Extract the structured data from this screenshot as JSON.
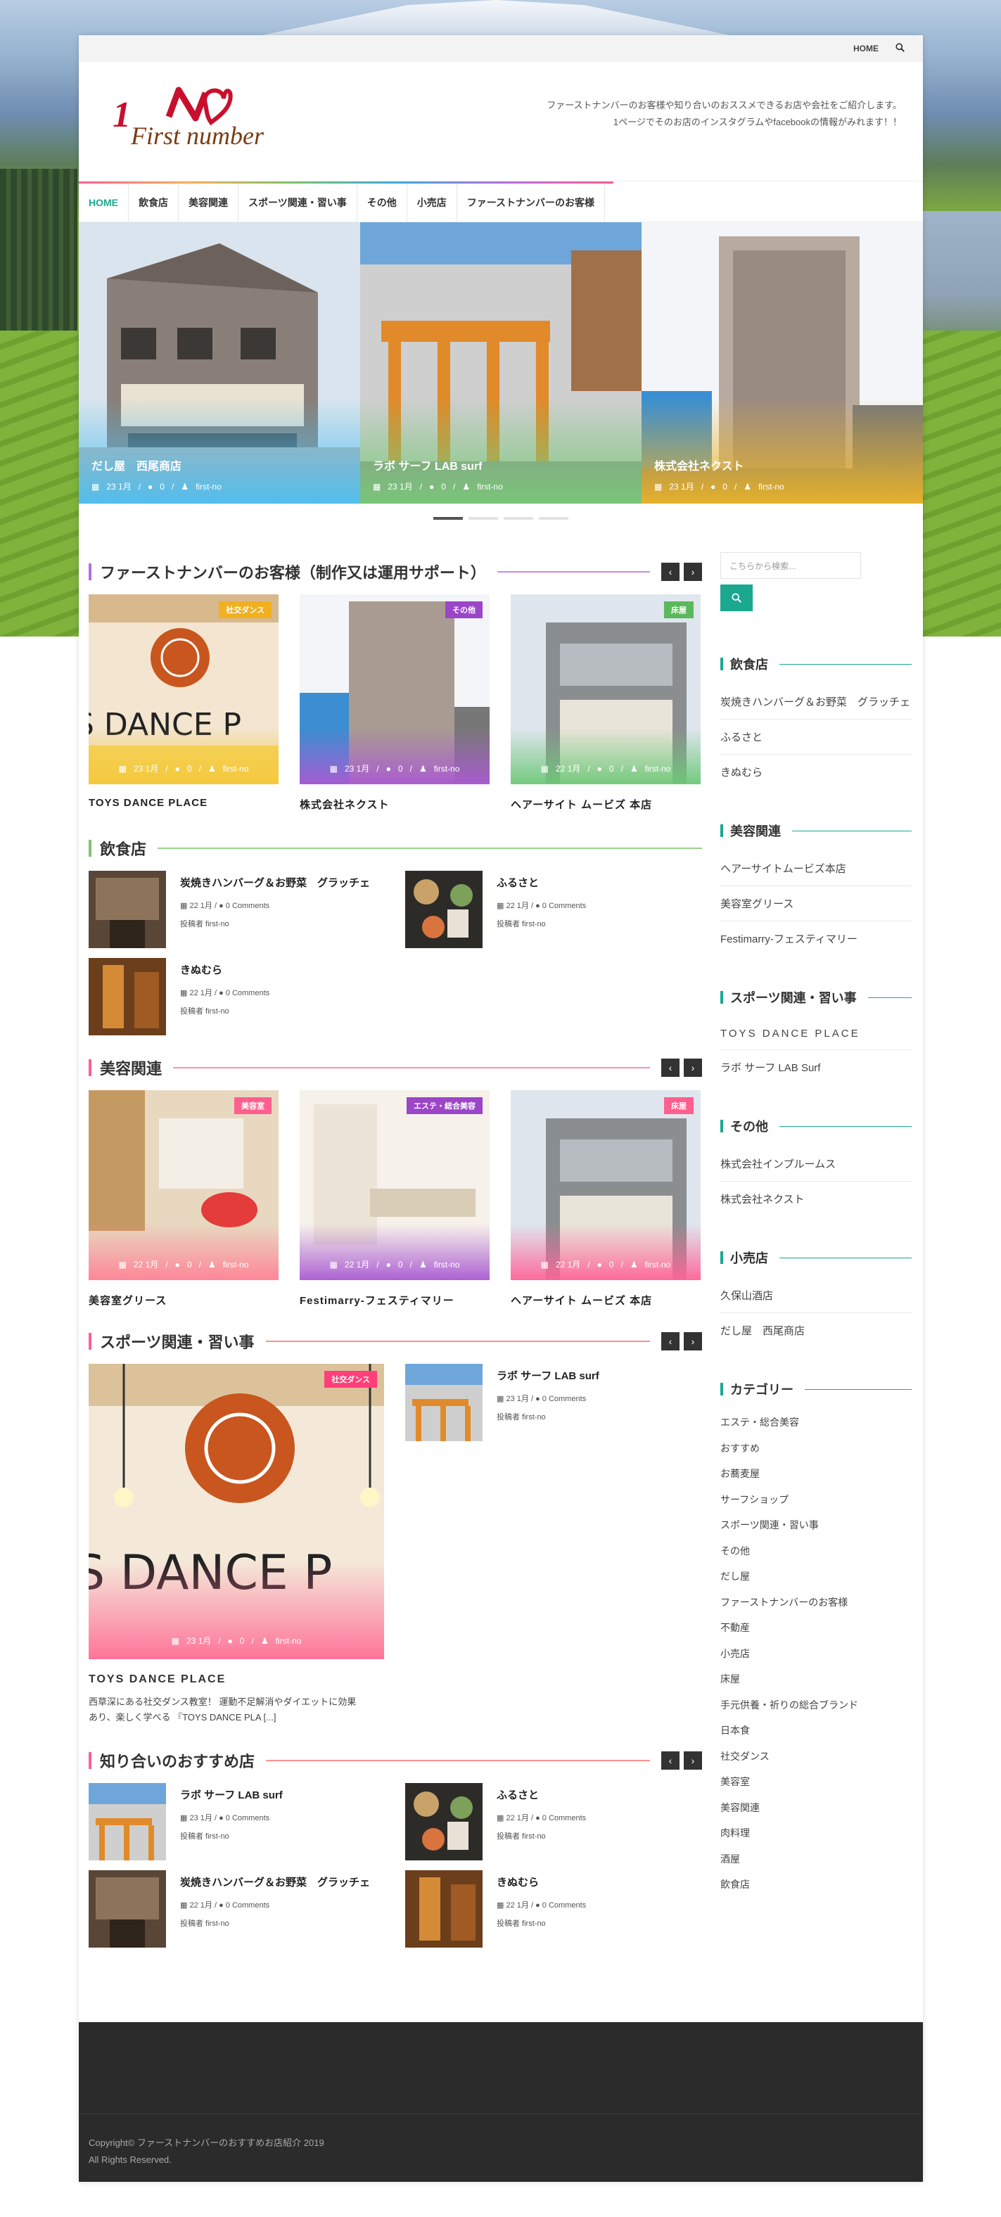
{
  "topbar": {
    "home": "HOME",
    "search_icon": "search-icon"
  },
  "header": {
    "logo_number": "1",
    "logo_text": "First number",
    "tagline_1": "ファーストナンバーのお客様や知り合いのおススメできるお店や会社をご紹介します。",
    "tagline_2": "1ページでそのお店のインスタグラムやfacebookの情報がみれます！！"
  },
  "nav": [
    "HOME",
    "飲食店",
    "美容関連",
    "スポーツ関連・習い事",
    "その他",
    "小売店",
    "ファーストナンバーのお客様"
  ],
  "slider": [
    {
      "title": "だし屋　西尾商店",
      "date": "23 1月",
      "comments": "0",
      "author": "first-no"
    },
    {
      "title": "ラボ サーフ LAB surf",
      "date": "23 1月",
      "comments": "0",
      "author": "first-no"
    },
    {
      "title": "株式会社ネクスト",
      "date": "23 1月",
      "comments": "0",
      "author": "first-no"
    }
  ],
  "section_customers": {
    "title": "ファーストナンバーのお客様（制作又は運用サポート）",
    "cards": [
      {
        "title": "TOYS DANCE PLACE",
        "badge": "社交ダンス",
        "date": "23 1月",
        "comments": "0",
        "author": "first-no"
      },
      {
        "title": "株式会社ネクスト",
        "badge": "その他",
        "date": "23 1月",
        "comments": "0",
        "author": "first-no"
      },
      {
        "title": "ヘアーサイト ムービズ 本店",
        "badge": "床屋",
        "date": "22 1月",
        "comments": "0",
        "author": "first-no"
      }
    ]
  },
  "section_food": {
    "title": "飲食店",
    "items": [
      {
        "title": "炭焼きハンバーグ＆お野菜　グラッチェ",
        "date": "22 1月",
        "comments": "0 Comments",
        "poster": "投稿者 first-no"
      },
      {
        "title": "ふるさと",
        "date": "22 1月",
        "comments": "0 Comments",
        "poster": "投稿者 first-no"
      },
      {
        "title": "きぬむら",
        "date": "22 1月",
        "comments": "0 Comments",
        "poster": "投稿者 first-no"
      }
    ]
  },
  "section_beauty": {
    "title": "美容関連",
    "cards": [
      {
        "title": "美容室グリース",
        "badge": "美容室",
        "date": "22 1月",
        "comments": "0",
        "author": "first-no"
      },
      {
        "title": "Festimarry-フェスティマリー",
        "badge": "エステ・総合美容",
        "date": "22 1月",
        "comments": "0",
        "author": "first-no"
      },
      {
        "title": "ヘアーサイト ムービズ 本店",
        "badge": "床屋",
        "date": "22 1月",
        "comments": "0",
        "author": "first-no"
      }
    ]
  },
  "section_sports": {
    "title": "スポーツ関連・習い事",
    "feature": {
      "title": "TOYS DANCE PLACE",
      "badge": "社交ダンス",
      "date": "23 1月",
      "comments": "0",
      "author": "first-no",
      "excerpt_1": "西草深にある社交ダンス教室！ 運動不足解消やダイエットに効果",
      "excerpt_2": "あり、楽しく学べる 『TOYS DANCE PLA [...]"
    },
    "item": {
      "title": "ラボ サーフ LAB surf",
      "date": "23 1月",
      "comments": "0 Comments",
      "poster": "投稿者 first-no"
    }
  },
  "section_friends": {
    "title": "知り合いのおすすめ店",
    "items": [
      {
        "title": "ラボ サーフ LAB surf",
        "date": "23 1月",
        "comments": "0 Comments",
        "poster": "投稿者 first-no"
      },
      {
        "title": "ふるさと",
        "date": "22 1月",
        "comments": "0 Comments",
        "poster": "投稿者 first-no"
      },
      {
        "title": "炭焼きハンバーグ＆お野菜　グラッチェ",
        "date": "22 1月",
        "comments": "0 Comments",
        "poster": "投稿者 first-no"
      },
      {
        "title": "きぬむら",
        "date": "22 1月",
        "comments": "0 Comments",
        "poster": "投稿者 first-no"
      }
    ]
  },
  "sidebar": {
    "search_placeholder": "こちらから検索...",
    "widgets": [
      {
        "title": "飲食店",
        "items": [
          "炭焼きハンバーグ＆お野菜　グラッチェ",
          "ふるさと",
          "きぬむら"
        ]
      },
      {
        "title": "美容関連",
        "items": [
          "ヘアーサイトムービズ本店",
          "美容室グリース",
          "Festimarry-フェスティマリー"
        ]
      },
      {
        "title": "スポーツ関連・習い事",
        "items": [
          "TOYS DANCE PLACE",
          "ラボ サーフ LAB Surf"
        ]
      },
      {
        "title": "その他",
        "items": [
          "株式会社インプルームス",
          "株式会社ネクスト"
        ]
      },
      {
        "title": "小売店",
        "items": [
          "久保山酒店",
          "だし屋　西尾商店"
        ]
      }
    ],
    "categories_title": "カテゴリー",
    "categories": [
      "エステ・総合美容",
      "おすすめ",
      "お蕎麦屋",
      "サーフショップ",
      "スポーツ関連・習い事",
      "その他",
      "だし屋",
      "ファーストナンバーのお客様",
      "不動産",
      "小売店",
      "床屋",
      "手元供養・祈りの総合ブランド",
      "日本食",
      "社交ダンス",
      "美容室",
      "美容関連",
      "肉料理",
      "酒屋",
      "飲食店"
    ]
  },
  "footer": {
    "copyright": "Copyright© ファーストナンバーのおすすめお店紹介 2019",
    "rights": "All Rights Reserved."
  },
  "colors": {
    "accent": "#1aa88f",
    "pink": "#ff5f8f",
    "dark": "#2b2b2b"
  }
}
